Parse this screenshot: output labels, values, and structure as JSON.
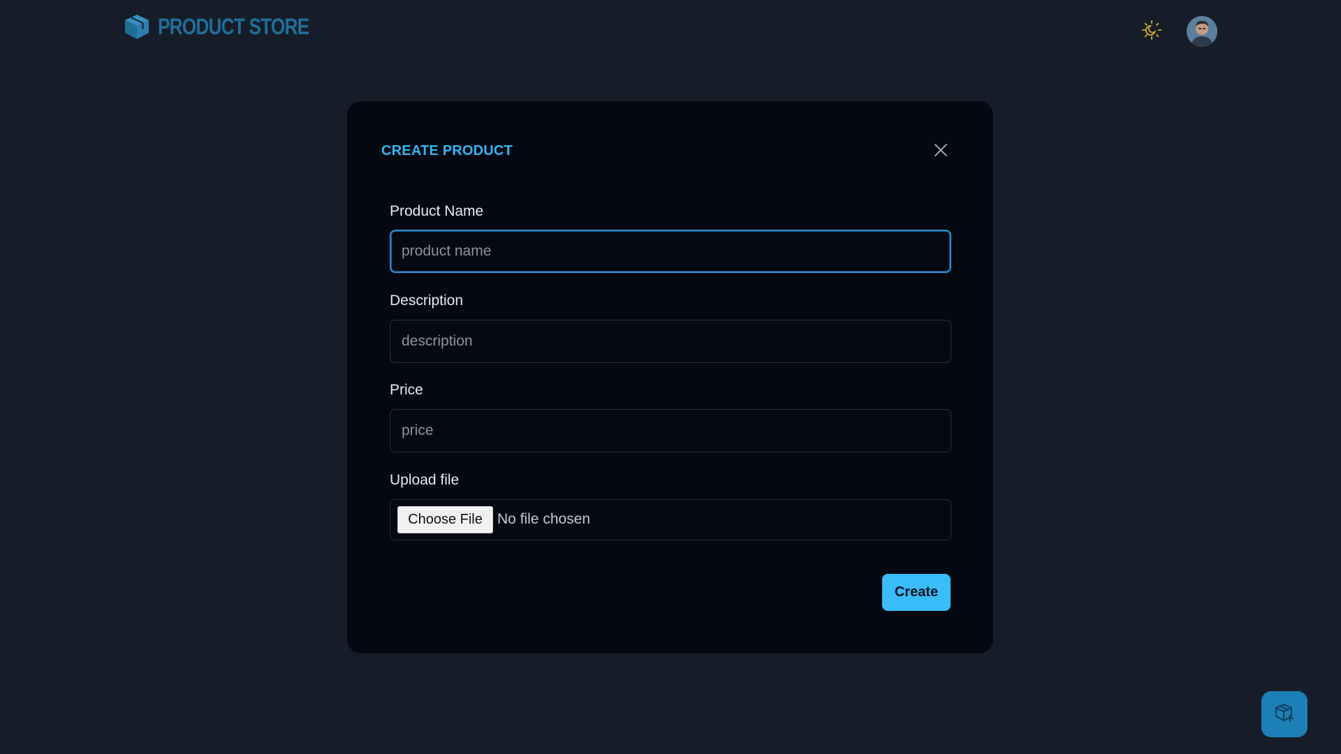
{
  "header": {
    "brand_name": "PRODUCT STORE",
    "logo_icon": "cube-icon",
    "theme_icon": "sun-moon-icon",
    "avatar_icon": "user-avatar"
  },
  "modal": {
    "title": "CREATE PRODUCT",
    "close_icon": "close-icon",
    "fields": {
      "name": {
        "label": "Product Name",
        "placeholder": "product name",
        "value": ""
      },
      "description": {
        "label": "Description",
        "placeholder": "description",
        "value": ""
      },
      "price": {
        "label": "Price",
        "placeholder": "price",
        "value": ""
      },
      "upload": {
        "label": "Upload file",
        "button_label": "Choose File",
        "status": "No file chosen"
      }
    },
    "submit_label": "Create"
  },
  "fab": {
    "icon": "add-product-icon"
  },
  "colors": {
    "accent": "#38bdf8",
    "title": "#35b4f2",
    "brand": "#1f6e98",
    "background": "#161d29",
    "modal_bg": "#040811",
    "theme_icon": "#c9a227"
  }
}
